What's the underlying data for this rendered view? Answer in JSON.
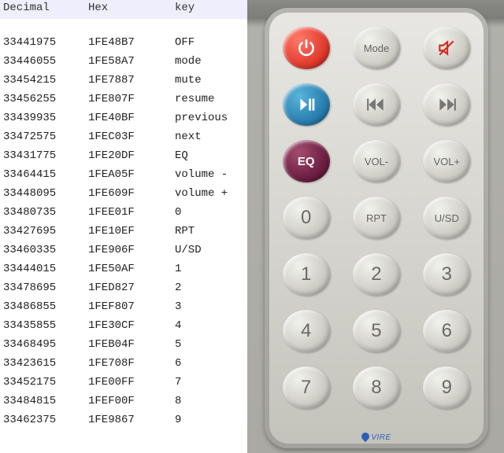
{
  "table": {
    "headers": {
      "decimal": "Decimal",
      "hex": "Hex",
      "key": "key"
    },
    "rows": [
      {
        "decimal": "33441975",
        "hex": "1FE48B7",
        "key": "OFF"
      },
      {
        "decimal": "33446055",
        "hex": "1FE58A7",
        "key": "mode"
      },
      {
        "decimal": "33454215",
        "hex": "1FE7887",
        "key": "mute"
      },
      {
        "decimal": "33456255",
        "hex": "1FE807F",
        "key": "resume"
      },
      {
        "decimal": "33439935",
        "hex": "1FE40BF",
        "key": "previous"
      },
      {
        "decimal": "33472575",
        "hex": "1FEC03F",
        "key": "next"
      },
      {
        "decimal": "33431775",
        "hex": "1FE20DF",
        "key": "EQ"
      },
      {
        "decimal": "33464415",
        "hex": "1FEA05F",
        "key": "volume -"
      },
      {
        "decimal": "33448095",
        "hex": "1FE609F",
        "key": "volume +"
      },
      {
        "decimal": "33480735",
        "hex": "1FEE01F",
        "key": "0"
      },
      {
        "decimal": "33427695",
        "hex": "1FE10EF",
        "key": "RPT"
      },
      {
        "decimal": "33460335",
        "hex": "1FE906F",
        "key": "U/SD"
      },
      {
        "decimal": "33444015",
        "hex": "1FE50AF",
        "key": "1"
      },
      {
        "decimal": "33478695",
        "hex": "1FED827",
        "key": "2"
      },
      {
        "decimal": "33486855",
        "hex": "1FEF807",
        "key": "3"
      },
      {
        "decimal": "33435855",
        "hex": "1FE30CF",
        "key": "4"
      },
      {
        "decimal": "33468495",
        "hex": "1FEB04F",
        "key": "5"
      },
      {
        "decimal": "33423615",
        "hex": "1FE708F",
        "key": "6"
      },
      {
        "decimal": "33452175",
        "hex": "1FE00FF",
        "key": "7"
      },
      {
        "decimal": "33484815",
        "hex": "1FEF00F",
        "key": "8"
      },
      {
        "decimal": "33462375",
        "hex": "1FE9867",
        "key": "9"
      }
    ]
  },
  "remote": {
    "brand": "VIRE",
    "buttons": {
      "mode": "Mode",
      "eq": "EQ",
      "vol_minus": "VOL-",
      "vol_plus": "VOL+",
      "zero": "0",
      "rpt": "RPT",
      "usd": "U/SD",
      "n1": "1",
      "n2": "2",
      "n3": "3",
      "n4": "4",
      "n5": "5",
      "n6": "6",
      "n7": "7",
      "n8": "8",
      "n9": "9"
    }
  }
}
